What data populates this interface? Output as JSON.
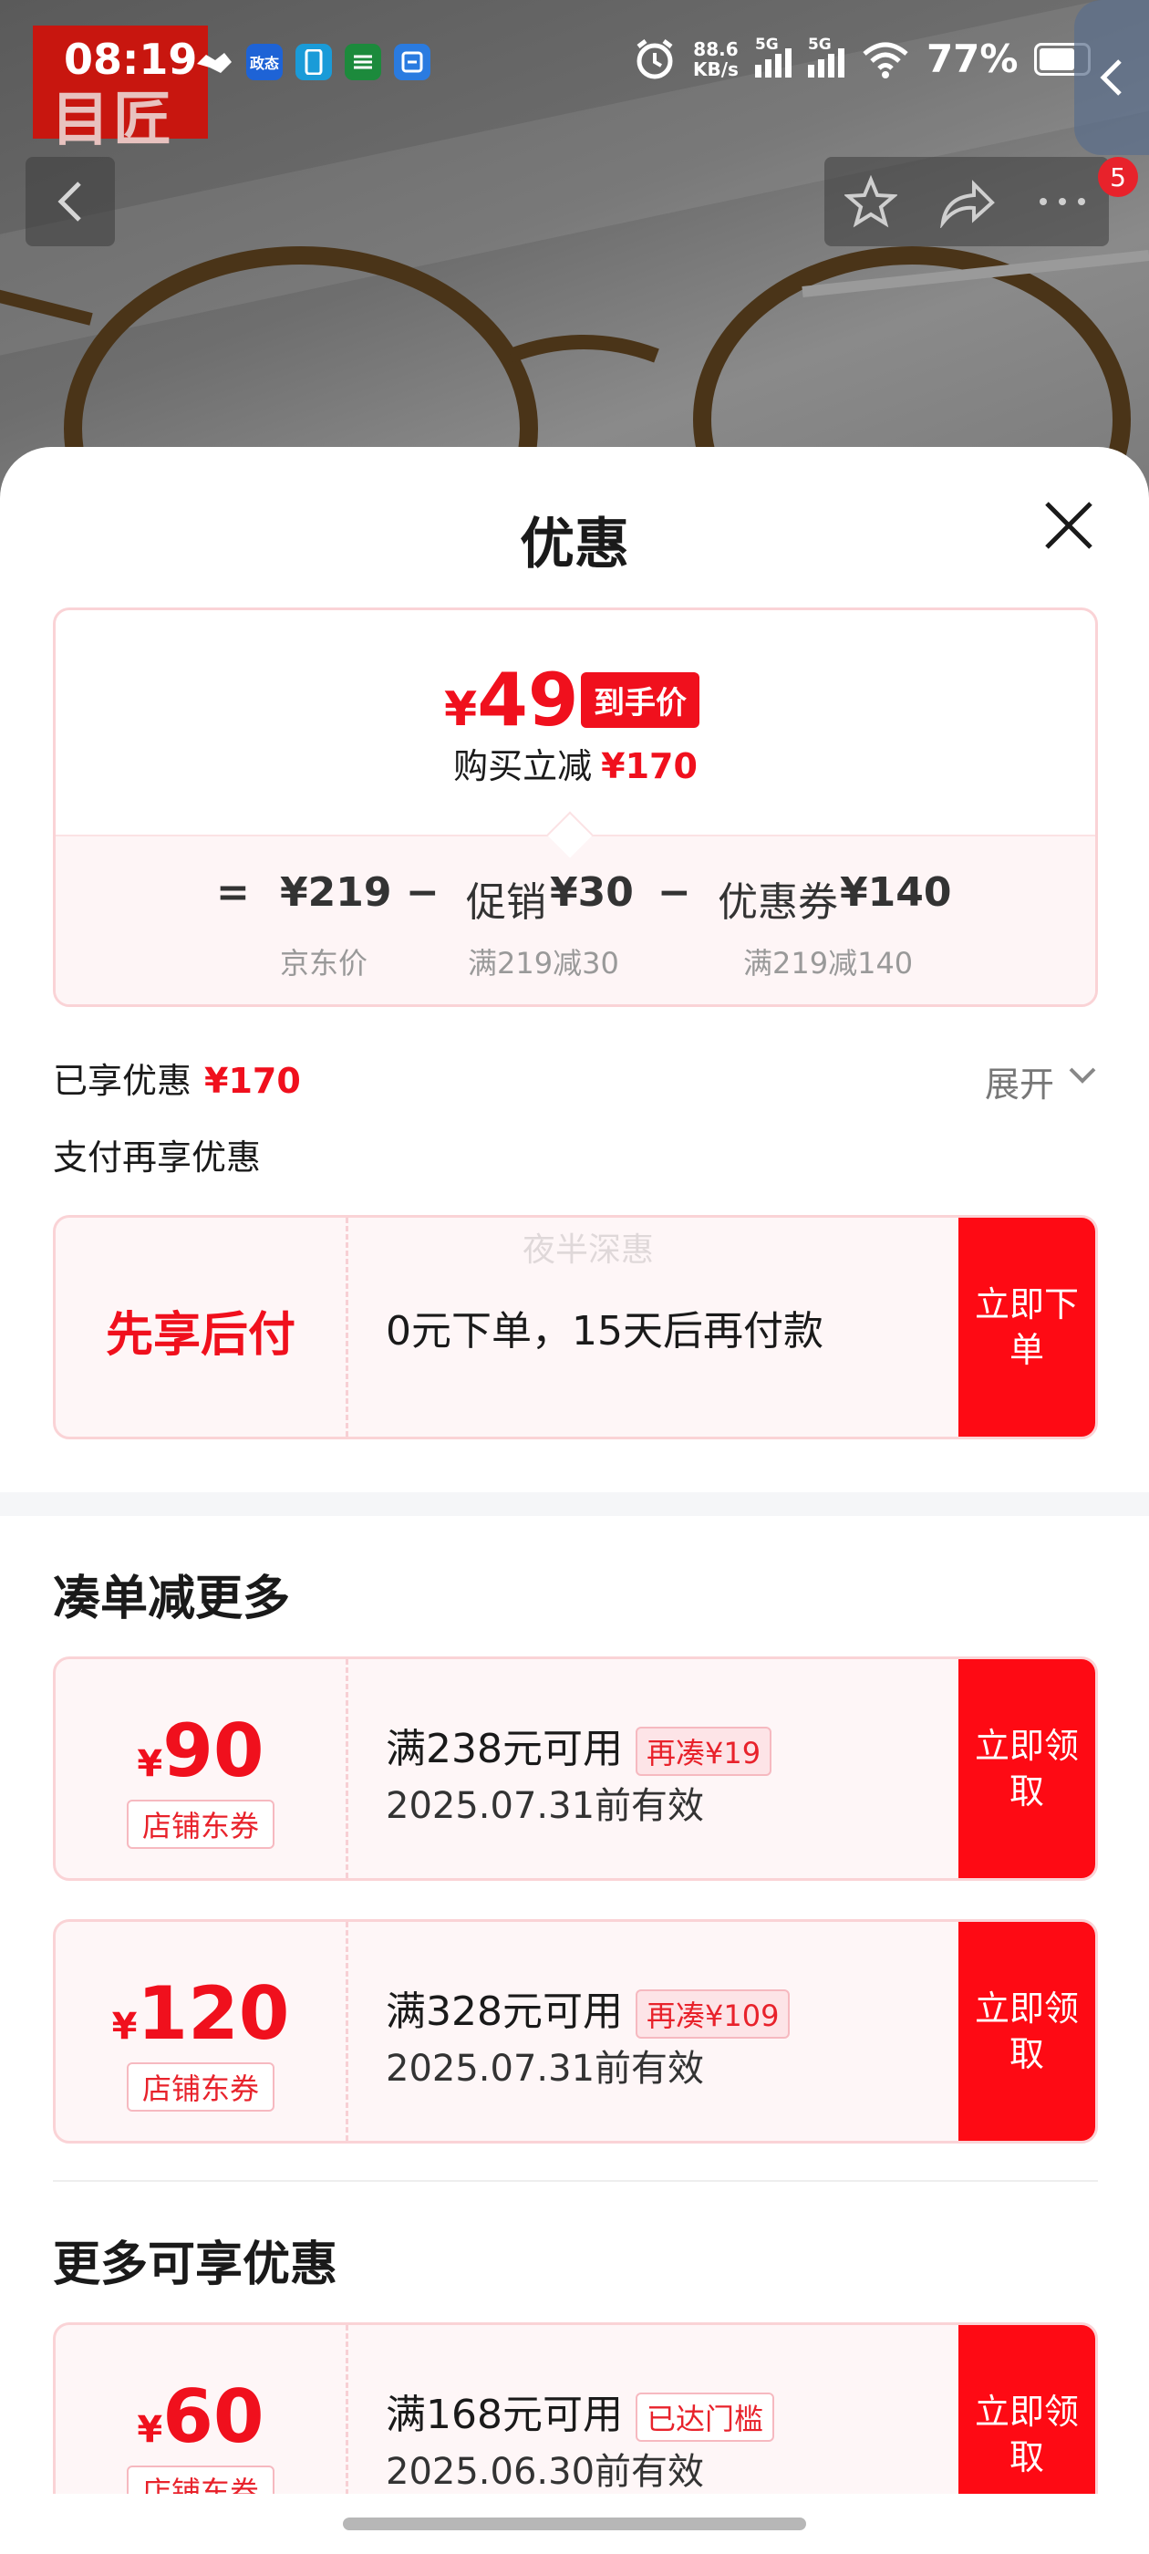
{
  "status_bar": {
    "time": "08:19",
    "net_speed_value": "88.6",
    "net_speed_unit": "KB/s",
    "signal1_label": "5G",
    "signal2_label": "5G",
    "battery_percent": "77%",
    "app_icons": [
      "handshake-icon",
      "政态",
      "phone-app-icon",
      "post-icon",
      "stack-app-icon"
    ],
    "mini_app_label": "政态"
  },
  "product_bg": {
    "logo_text": "目匠"
  },
  "nav": {
    "badge_count": "5"
  },
  "sheet": {
    "title": "优惠",
    "price_card": {
      "currency": "¥",
      "final_price": "49",
      "final_tag": "到手价",
      "discount_label": "购买立减",
      "discount_amount": "¥170",
      "equals": "=",
      "minus1": "−",
      "minus2": "−",
      "jd_price": "¥219",
      "jd_price_label": "京东价",
      "promo_label": "促销",
      "promo_amount": "¥30",
      "promo_note": "满219减30",
      "coupon_label": "优惠券",
      "coupon_amount": "¥140",
      "coupon_note": "满219减140"
    },
    "enjoyed_label": "已享优惠",
    "enjoyed_amount": "¥170",
    "expand_label": "展开",
    "pay_more_label": "支付再享优惠",
    "bnpl": {
      "title": "先享后付",
      "desc": "0元下单，15天后再付款",
      "watermark": "夜半深惠",
      "cta": "立即下单"
    },
    "section_more": "凑单减更多",
    "section_available": "更多可享优惠",
    "coupons_more": [
      {
        "currency": "¥",
        "amount": "90",
        "tag": "店铺东券",
        "condition": "满238元可用",
        "pill": "再凑¥19",
        "expiry": "2025.07.31前有效",
        "cta": "立即领取"
      },
      {
        "currency": "¥",
        "amount": "120",
        "tag": "店铺东券",
        "condition": "满328元可用",
        "pill": "再凑¥109",
        "expiry": "2025.07.31前有效",
        "cta": "立即领取"
      }
    ],
    "coupons_available": [
      {
        "currency": "¥",
        "amount": "60",
        "tag": "店铺东券",
        "condition": "满168元可用",
        "pill": "已达门槛",
        "expiry": "2025.06.30前有效",
        "cta": "立即领取"
      }
    ]
  },
  "colors": {
    "accent": "#f0101d",
    "cta": "#fe0a14",
    "card_border": "#fad3d6",
    "card_bg": "#fef6f7"
  }
}
